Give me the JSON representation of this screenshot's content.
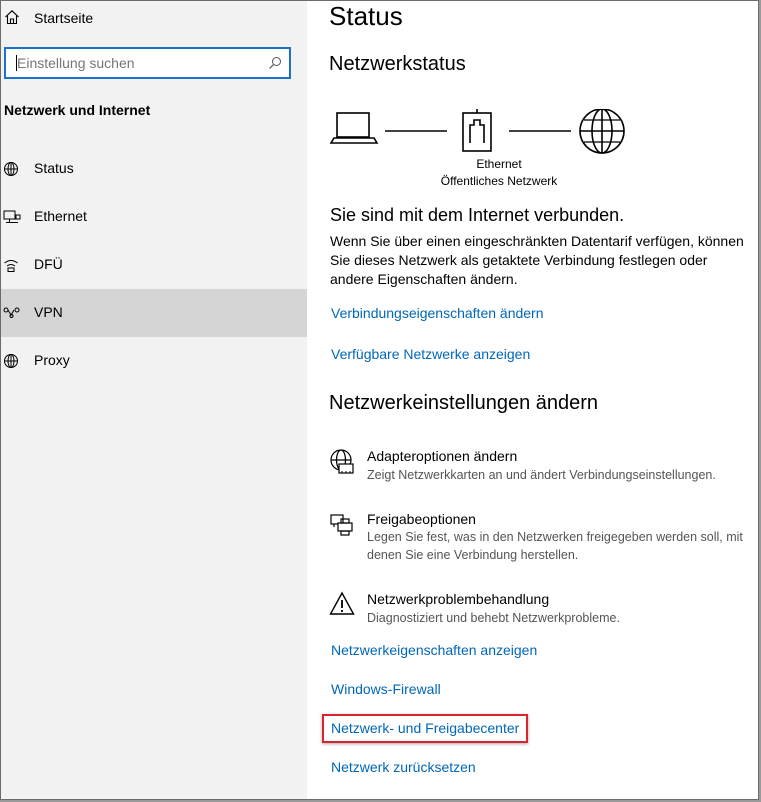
{
  "sidebar": {
    "home_label": "Startseite",
    "search_placeholder": "Einstellung suchen",
    "section_title": "Netzwerk und Internet",
    "items": [
      {
        "label": "Status",
        "icon": "globe-icon"
      },
      {
        "label": "Ethernet",
        "icon": "ethernet-icon"
      },
      {
        "label": "DFÜ",
        "icon": "dialup-icon"
      },
      {
        "label": "VPN",
        "icon": "vpn-icon"
      },
      {
        "label": "Proxy",
        "icon": "globe-icon"
      }
    ],
    "active_item": "VPN"
  },
  "main": {
    "title": "Status",
    "network_status_heading": "Netzwerkstatus",
    "diagram": {
      "adapter_name": "Ethernet",
      "network_type": "Öffentliches Netzwerk"
    },
    "connected_text": "Sie sind mit dem Internet verbunden.",
    "description": "Wenn Sie über einen eingeschränkten Datentarif verfügen, können Sie dieses Netzwerk als getaktete Verbindung festlegen oder andere Eigenschaften ändern.",
    "links_top": {
      "change_connection_properties": "Verbindungseigenschaften ändern",
      "show_available_networks": "Verfügbare Netzwerke anzeigen"
    },
    "change_settings_heading": "Netzwerkeinstellungen ändern",
    "options": [
      {
        "title": "Adapteroptionen ändern",
        "description": "Zeigt Netzwerkkarten an und ändert Verbindungseinstellungen.",
        "icon": "adapter-globe-icon"
      },
      {
        "title": "Freigabeoptionen",
        "description": "Legen Sie fest, was in den Netzwerken freigegeben werden soll, mit denen Sie eine Verbindung herstellen.",
        "icon": "sharing-icon"
      },
      {
        "title": "Netzwerkproblembehandlung",
        "description": "Diagnostiziert und behebt Netzwerkprobleme.",
        "icon": "warning-icon"
      }
    ],
    "links_bottom": {
      "network_properties": "Netzwerkeigenschaften anzeigen",
      "firewall": "Windows-Firewall",
      "sharing_center": "Netzwerk- und Freigabecenter",
      "reset_network": "Netzwerk zurücksetzen"
    }
  },
  "colors": {
    "link": "#0067b8",
    "sidebar_bg": "#f2f2f2",
    "active_item_bg": "#d5d5d5",
    "search_border": "#1a73c8",
    "highlight_border": "#d9262e"
  }
}
